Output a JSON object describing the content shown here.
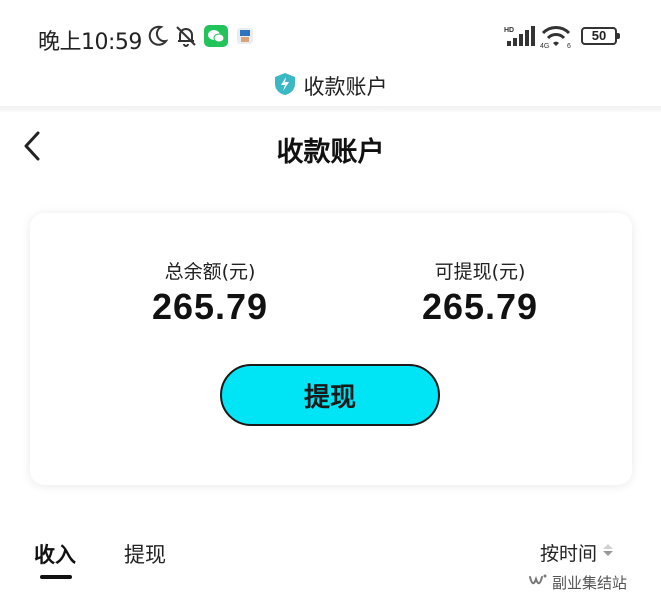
{
  "status_bar": {
    "time": "晚上10:59",
    "battery": "50",
    "icons": [
      "moon-icon",
      "bell-off-icon",
      "wechat-icon",
      "app-notification-icon",
      "hd-signal-icon",
      "wifi-icon",
      "battery-icon"
    ]
  },
  "mini_title": {
    "icon": "shield-bolt-icon",
    "text": "收款账户"
  },
  "nav": {
    "back_icon": "chevron-left-icon",
    "title": "收款账户"
  },
  "balance": {
    "total_label": "总余额(元)",
    "total_value": "265.79",
    "available_label": "可提现(元)",
    "available_value": "265.79",
    "withdraw_button": "提现"
  },
  "tabs": [
    {
      "label": "收入",
      "active": true
    },
    {
      "label": "提现",
      "active": false
    }
  ],
  "sort": {
    "label": "按时间",
    "icon": "sort-triangle-icon"
  },
  "watermark": {
    "text": "副业集结站",
    "icon": "wechat-channel-icon"
  },
  "colors": {
    "accent": "#00e5f5",
    "shield": "#3bb8c4"
  }
}
